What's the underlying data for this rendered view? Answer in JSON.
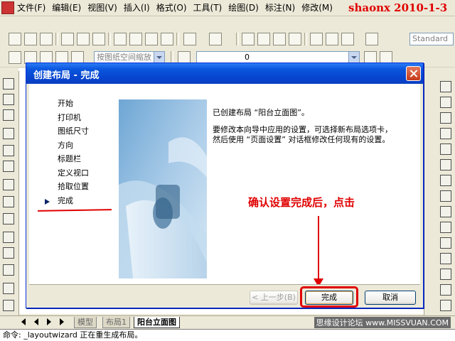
{
  "app": {
    "menu": [
      "文件(F)",
      "编辑(E)",
      "视图(V)",
      "插入(I)",
      "格式(O)",
      "工具(T)",
      "绘图(D)",
      "标注(N)",
      "修改(M)"
    ],
    "watermark_top": "shaonx 2010-1-3"
  },
  "toolbar": {
    "standard_label": "Standard",
    "layer_combo": "按图纸空间缩放",
    "layer_value": "0"
  },
  "layout_tabs": {
    "tabs": [
      "模型",
      "布局1",
      "阳台立面图"
    ]
  },
  "forum_watermark": "思缘设计论坛 www.MISSVUAN.COM",
  "command_line": "命令: _layoutwizard 正在重生成布局。",
  "dialog": {
    "title": "创建布局 - 完成",
    "steps": [
      "开始",
      "打印机",
      "图纸尺寸",
      "方向",
      "标题栏",
      "定义视口",
      "拾取位置",
      "完成"
    ],
    "message_done": "已创建布局 “阳台立面图”。",
    "message_info": "要修改本向导中应用的设置，可选择新布局选项卡，然后使用 “页面设置” 对话框修改任何现有的设置。",
    "annotation": "确认设置完成后，点击",
    "buttons": {
      "back": "< 上一步(B)",
      "finish": "完成",
      "cancel": "取消"
    }
  },
  "colors": {
    "annotation_red": "#e00000",
    "title_blue": "#0a55dd"
  }
}
